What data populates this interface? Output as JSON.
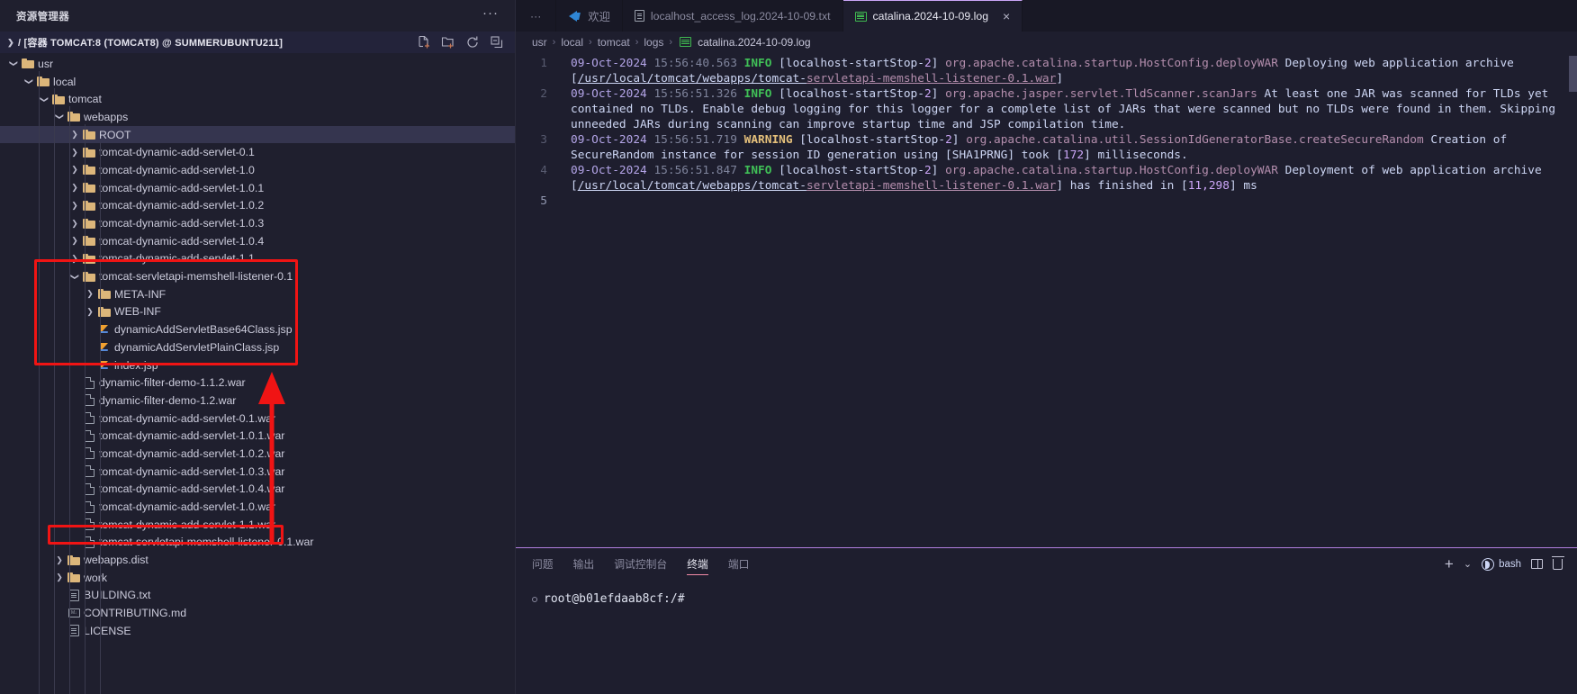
{
  "sidebar": {
    "title": "资源管理器",
    "more_label": "···",
    "section": {
      "label": "/ [容器 TOMCAT:8 (TOMCAT8) @ SUMMERUBUNTU211]",
      "actions": [
        "new-file-icon",
        "new-folder-icon",
        "refresh-icon",
        "collapse-all-icon"
      ]
    },
    "tree": [
      {
        "label": "usr",
        "type": "folder",
        "depth": 0,
        "state": "expanded"
      },
      {
        "label": "local",
        "type": "folder",
        "depth": 1,
        "state": "expanded"
      },
      {
        "label": "tomcat",
        "type": "folder",
        "depth": 2,
        "state": "expanded"
      },
      {
        "label": "webapps",
        "type": "folder",
        "depth": 3,
        "state": "expanded"
      },
      {
        "label": "ROOT",
        "type": "folder",
        "depth": 4,
        "state": "collapsed",
        "selected": true
      },
      {
        "label": "tomcat-dynamic-add-servlet-0.1",
        "type": "folder",
        "depth": 4,
        "state": "collapsed"
      },
      {
        "label": "tomcat-dynamic-add-servlet-1.0",
        "type": "folder",
        "depth": 4,
        "state": "collapsed"
      },
      {
        "label": "tomcat-dynamic-add-servlet-1.0.1",
        "type": "folder",
        "depth": 4,
        "state": "collapsed"
      },
      {
        "label": "tomcat-dynamic-add-servlet-1.0.2",
        "type": "folder",
        "depth": 4,
        "state": "collapsed"
      },
      {
        "label": "tomcat-dynamic-add-servlet-1.0.3",
        "type": "folder",
        "depth": 4,
        "state": "collapsed"
      },
      {
        "label": "tomcat-dynamic-add-servlet-1.0.4",
        "type": "folder",
        "depth": 4,
        "state": "collapsed"
      },
      {
        "label": "tomcat-dynamic-add-servlet-1.1",
        "type": "folder",
        "depth": 4,
        "state": "collapsed"
      },
      {
        "label": "tomcat-servletapi-memshell-listener-0.1",
        "type": "folder",
        "depth": 4,
        "state": "expanded"
      },
      {
        "label": "META-INF",
        "type": "folder",
        "depth": 5,
        "state": "collapsed"
      },
      {
        "label": "WEB-INF",
        "type": "folder",
        "depth": 5,
        "state": "collapsed"
      },
      {
        "label": "dynamicAddServletBase64Class.jsp",
        "type": "jsp",
        "depth": 5,
        "state": "leaf"
      },
      {
        "label": "dynamicAddServletPlainClass.jsp",
        "type": "jsp",
        "depth": 5,
        "state": "leaf"
      },
      {
        "label": "index.jsp",
        "type": "jsp",
        "depth": 5,
        "state": "leaf"
      },
      {
        "label": "dynamic-filter-demo-1.1.2.war",
        "type": "file",
        "depth": 4,
        "state": "leaf"
      },
      {
        "label": "dynamic-filter-demo-1.2.war",
        "type": "file",
        "depth": 4,
        "state": "leaf"
      },
      {
        "label": "tomcat-dynamic-add-servlet-0.1.war",
        "type": "file",
        "depth": 4,
        "state": "leaf"
      },
      {
        "label": "tomcat-dynamic-add-servlet-1.0.1.war",
        "type": "file",
        "depth": 4,
        "state": "leaf"
      },
      {
        "label": "tomcat-dynamic-add-servlet-1.0.2.war",
        "type": "file",
        "depth": 4,
        "state": "leaf"
      },
      {
        "label": "tomcat-dynamic-add-servlet-1.0.3.war",
        "type": "file",
        "depth": 4,
        "state": "leaf"
      },
      {
        "label": "tomcat-dynamic-add-servlet-1.0.4.war",
        "type": "file",
        "depth": 4,
        "state": "leaf"
      },
      {
        "label": "tomcat-dynamic-add-servlet-1.0.war",
        "type": "file",
        "depth": 4,
        "state": "leaf"
      },
      {
        "label": "tomcat-dynamic-add-servlet-1.1.war",
        "type": "file",
        "depth": 4,
        "state": "leaf"
      },
      {
        "label": "tomcat-servletapi-memshell-listener-0.1.war",
        "type": "file",
        "depth": 4,
        "state": "leaf"
      },
      {
        "label": "webapps.dist",
        "type": "folder",
        "depth": 3,
        "state": "collapsed"
      },
      {
        "label": "work",
        "type": "folder",
        "depth": 3,
        "state": "collapsed"
      },
      {
        "label": "BUILDING.txt",
        "type": "txt",
        "depth": 3,
        "state": "leaf"
      },
      {
        "label": "CONTRIBUTING.md",
        "type": "md",
        "depth": 3,
        "state": "leaf"
      },
      {
        "label": "LICENSE",
        "type": "txt",
        "depth": 3,
        "state": "leaf"
      }
    ],
    "annotations": {
      "highlight_color": "#f01414",
      "box_1_target": "tomcat-servletapi-memshell-listener-0.1",
      "box_2_target": "tomcat-servletapi-memshell-listener-0.1.war",
      "arrow_from": "tomcat-servletapi-memshell-listener-0.1.war",
      "arrow_to": "tomcat-servletapi-memshell-listener-0.1"
    }
  },
  "tabs": {
    "overflow_label": "···",
    "items": [
      {
        "label": "欢迎",
        "icon": "vscode-logo-icon",
        "active": false
      },
      {
        "label": "localhost_access_log.2024-10-09.txt",
        "icon": "text-file-icon",
        "active": false
      },
      {
        "label": "catalina.2024-10-09.log",
        "icon": "log-file-icon",
        "active": true,
        "close": "×"
      }
    ]
  },
  "breadcrumb": {
    "separator": "›",
    "items": [
      "usr",
      "local",
      "tomcat",
      "logs",
      "catalina.2024-10-09.log"
    ],
    "file_icon": "log-file-icon"
  },
  "editor": {
    "lines": [
      {
        "number": "1",
        "segments": [
          {
            "text": "09-Oct-2024 ",
            "style": "date"
          },
          {
            "text": "15:56:40.563 ",
            "style": "time"
          },
          {
            "text": "INFO",
            "style": "info"
          },
          {
            "text": " [localhost-startStop-",
            "style": "plain"
          },
          {
            "text": "2",
            "style": "num"
          },
          {
            "text": "] ",
            "style": "plain"
          },
          {
            "text": "org.apache.catalina.startup.HostConfig.deployWAR",
            "style": "class"
          },
          {
            "text": " Deploying web application archive [",
            "style": "plain"
          },
          {
            "text": "/usr/local/tomcat/webapps/tomcat-",
            "style": "plain-underline"
          },
          {
            "text": "servletapi-memshell-listener-0.1.war",
            "style": "link"
          },
          {
            "text": "]",
            "style": "plain"
          }
        ]
      },
      {
        "number": "2",
        "segments": [
          {
            "text": "09-Oct-2024 ",
            "style": "date"
          },
          {
            "text": "15:56:51.326 ",
            "style": "time"
          },
          {
            "text": "INFO",
            "style": "info"
          },
          {
            "text": " [localhost-startStop-",
            "style": "plain"
          },
          {
            "text": "2",
            "style": "num"
          },
          {
            "text": "] ",
            "style": "plain"
          },
          {
            "text": "org.apache.jasper.servlet.TldScanner.scanJars",
            "style": "class"
          },
          {
            "text": " At least one JAR was scanned for TLDs yet contained no TLDs. Enable debug logging for this logger for a complete list of JARs that were scanned but no TLDs were found in them. Skipping unneeded JARs during scanning can improve startup time and JSP compilation time.",
            "style": "plain"
          }
        ]
      },
      {
        "number": "3",
        "segments": [
          {
            "text": "09-Oct-2024 ",
            "style": "date"
          },
          {
            "text": "15:56:51.719 ",
            "style": "time"
          },
          {
            "text": "WARNING",
            "style": "warn"
          },
          {
            "text": " [localhost-startStop-",
            "style": "plain"
          },
          {
            "text": "2",
            "style": "num"
          },
          {
            "text": "] ",
            "style": "plain"
          },
          {
            "text": "org.apache.catalina.util.SessionIdGeneratorBase.createSecureRandom",
            "style": "class"
          },
          {
            "text": " Creation of SecureRandom instance for session ID generation using [SHA1PRNG] took [",
            "style": "plain"
          },
          {
            "text": "172",
            "style": "num"
          },
          {
            "text": "] milliseconds.",
            "style": "plain"
          }
        ]
      },
      {
        "number": "4",
        "segments": [
          {
            "text": "09-Oct-2024 ",
            "style": "date"
          },
          {
            "text": "15:56:51.847 ",
            "style": "time"
          },
          {
            "text": "INFO",
            "style": "info"
          },
          {
            "text": " [localhost-startStop-",
            "style": "plain"
          },
          {
            "text": "2",
            "style": "num"
          },
          {
            "text": "] ",
            "style": "plain"
          },
          {
            "text": "org.apache.catalina.startup.HostConfig.deployWAR",
            "style": "class"
          },
          {
            "text": " Deployment of web application archive [",
            "style": "plain"
          },
          {
            "text": "/usr/local/tomcat/webapps/tomcat-",
            "style": "plain-underline"
          },
          {
            "text": "servletapi-memshell-listener-0.1.war",
            "style": "link"
          },
          {
            "text": "] has finished in [",
            "style": "plain"
          },
          {
            "text": "11,298",
            "style": "num"
          },
          {
            "text": "] ms",
            "style": "plain"
          }
        ]
      },
      {
        "number": "5",
        "segments": [],
        "is_cursor_line": true
      }
    ]
  },
  "panel": {
    "tabs": [
      {
        "label": "问题",
        "active": false
      },
      {
        "label": "输出",
        "active": false
      },
      {
        "label": "调试控制台",
        "active": false
      },
      {
        "label": "终端",
        "active": true
      },
      {
        "label": "端口",
        "active": false
      }
    ],
    "actions": {
      "new_terminal": "+",
      "dropdown": "⌄",
      "shell_name": "bash",
      "split": "split-terminal-icon",
      "kill": "kill-terminal-icon"
    },
    "terminal_prompt": "root@b01efdaab8cf:/#"
  }
}
